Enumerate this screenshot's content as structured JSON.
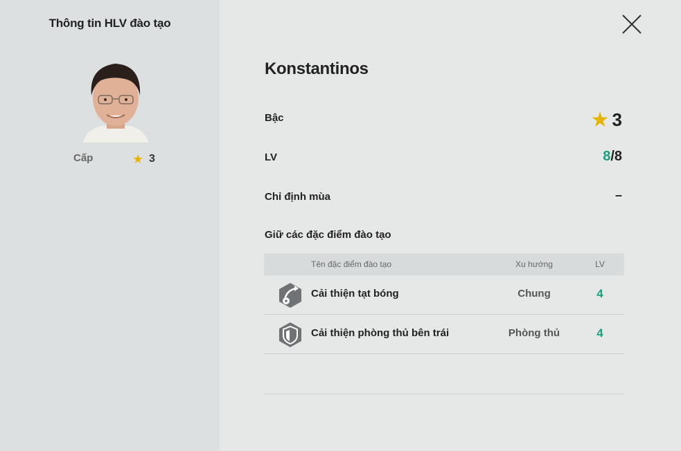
{
  "left_panel": {
    "title": "Thông tin HLV đào tạo",
    "grade_label": "Cấp",
    "grade_value": "3",
    "star_icon": "star-icon"
  },
  "close_icon": "close-icon",
  "coach": {
    "name": "Konstantinos",
    "tier_label": "Bậc",
    "tier_value": "3",
    "lv_label": "LV",
    "lv_current": "8",
    "lv_max": "/8",
    "season_label": "Chỉ định mùa",
    "season_value": "–"
  },
  "traits": {
    "section_title": "Giữ các đặc điểm đào tạo",
    "headers": {
      "name": "Tên đặc điểm đào tạo",
      "type": "Xu hướng",
      "lv": "LV"
    },
    "rows": [
      {
        "icon": "crossing-ball-icon",
        "name": "Cải thiện tạt bóng",
        "type": "Chung",
        "lv": "4"
      },
      {
        "icon": "shield-icon",
        "name": "Cải thiện phòng thủ bên trái",
        "type": "Phòng thủ",
        "lv": "4"
      }
    ]
  },
  "colors": {
    "accent_green": "#17a17e",
    "star_gold": "#e6b400",
    "left_bg": "#dde0e1",
    "main_bg": "#e6e7e7"
  }
}
